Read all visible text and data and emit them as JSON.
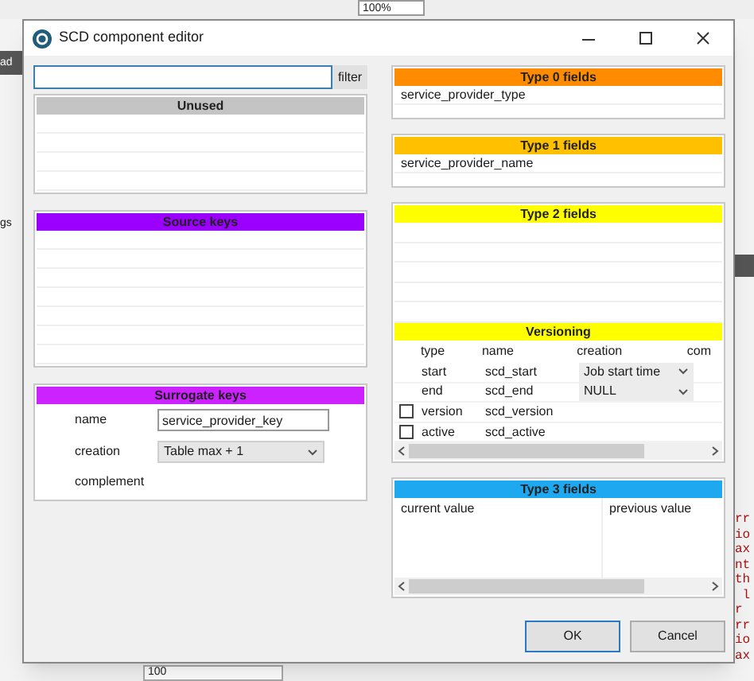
{
  "background": {
    "zoom_field": "100%",
    "left_fragments": [
      "ad",
      "gs"
    ],
    "bottom_field": "100",
    "code_lines": [
      "rr",
      "io",
      "ax",
      "nt",
      "th",
      " l",
      "r",
      "rr",
      "io",
      "ax"
    ]
  },
  "window": {
    "title": "SCD component editor"
  },
  "filter": {
    "button": "filter"
  },
  "left_panels": [
    {
      "kind": "list",
      "title": "Unused",
      "color": "#c4c4c4"
    },
    {
      "kind": "list",
      "title": "Source keys",
      "color": "#9b00ff"
    },
    {
      "kind": "surrogate",
      "title": "Surrogate keys",
      "color": "#cc22ff",
      "name_label": "name",
      "name_value": "service_provider_key",
      "creation_label": "creation",
      "creation_value": "Table max + 1",
      "complement_label": "complement"
    }
  ],
  "right_panels": [
    {
      "kind": "list",
      "title": "Type 0 fields",
      "color": "#ff8c00",
      "items": [
        "service_provider_type"
      ]
    },
    {
      "kind": "list",
      "title": "Type 1 fields",
      "color": "#ffc000",
      "items": [
        "service_provider_name"
      ]
    },
    {
      "kind": "type2",
      "title": "Type 2 fields",
      "color": "#ffff00",
      "versioning_title": "Versioning",
      "columns": [
        "type",
        "name",
        "creation",
        "com"
      ],
      "rows": [
        {
          "kind": "fixed",
          "type": "start",
          "name": "scd_start",
          "creation": "Job start time"
        },
        {
          "kind": "fixed",
          "type": "end",
          "name": "scd_end",
          "creation": "NULL"
        },
        {
          "kind": "optional",
          "checked": false,
          "type": "version",
          "name": "scd_version"
        },
        {
          "kind": "optional",
          "checked": false,
          "type": "active",
          "name": "scd_active"
        }
      ]
    },
    {
      "kind": "type3",
      "title": "Type 3 fields",
      "color": "#1ea8f0",
      "columns": [
        "current value",
        "previous value"
      ]
    }
  ],
  "buttons": [
    {
      "label": "OK",
      "selected": true
    },
    {
      "label": "Cancel",
      "selected": false
    }
  ]
}
